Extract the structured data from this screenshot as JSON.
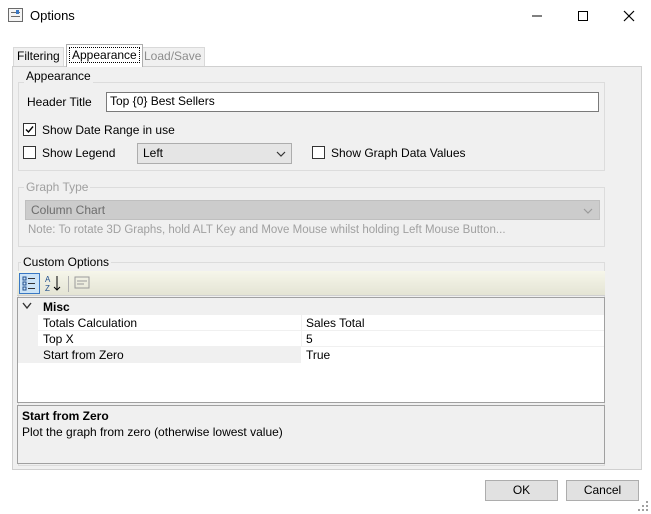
{
  "window": {
    "title": "Options",
    "controls": {
      "minimize_icon": "minimize-icon",
      "maximize_icon": "maximize-icon",
      "close_icon": "close-icon"
    }
  },
  "tabs": [
    {
      "label": "Filtering",
      "state": "normal"
    },
    {
      "label": "Appearance",
      "state": "selected"
    },
    {
      "label": "Load/Save",
      "state": "disabled"
    }
  ],
  "appearance": {
    "group_label": "Appearance",
    "header_title_label": "Header Title",
    "header_title_value": "Top {0} Best Sellers",
    "show_date_range_label": "Show Date Range in use",
    "show_date_range_checked": true,
    "show_legend_label": "Show Legend",
    "show_legend_checked": false,
    "legend_position_value": "Left",
    "show_graph_values_label": "Show Graph Data Values",
    "show_graph_values_checked": false
  },
  "graph_type": {
    "group_label": "Graph Type",
    "selected": "Column Chart",
    "note": "Note: To rotate 3D Graphs, hold ALT Key and Move Mouse whilst holding Left Mouse Button..."
  },
  "custom_options": {
    "group_label": "Custom Options",
    "toolbar_icons": [
      "categorized-icon",
      "alphabetical-sort-icon",
      "property-pages-icon"
    ],
    "category": "Misc",
    "properties": [
      {
        "name": "Totals Calculation",
        "value": "Sales Total"
      },
      {
        "name": "Top X",
        "value": "5"
      },
      {
        "name": "Start from Zero",
        "value": "True"
      }
    ],
    "description_title": "Start from Zero",
    "description_text": "Plot the graph from zero (otherwise lowest value)"
  },
  "buttons": {
    "ok": "OK",
    "cancel": "Cancel"
  },
  "colors": {
    "selection_blue": "#3a78c4",
    "panel_bg": "#f0f0f0"
  }
}
